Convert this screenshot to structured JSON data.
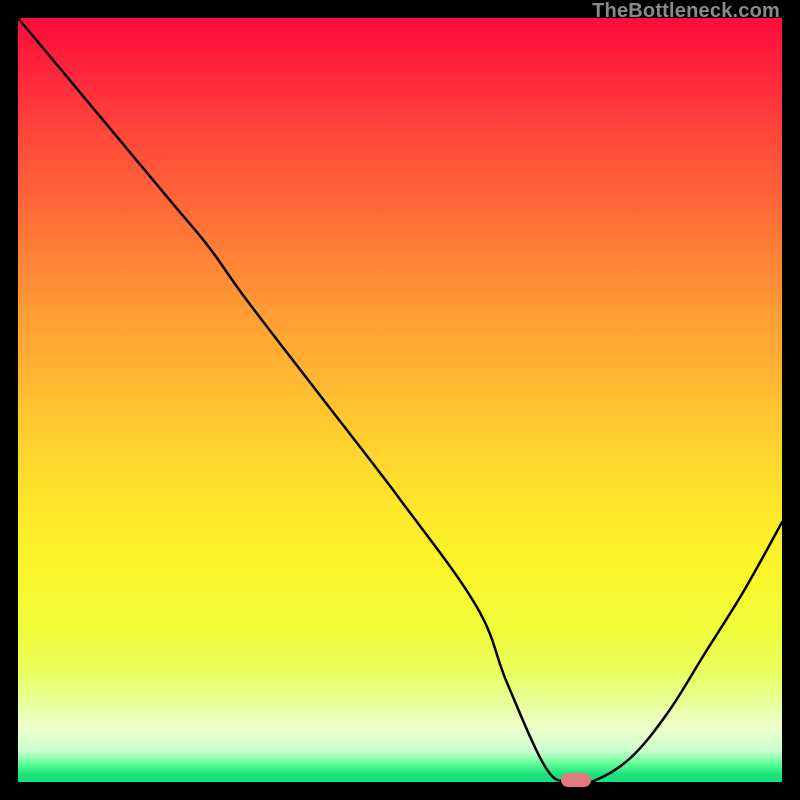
{
  "watermark": "TheBottleneck.com",
  "marker": {
    "color": "#e37b7e"
  },
  "chart_data": {
    "type": "line",
    "title": "",
    "xlabel": "",
    "ylabel": "",
    "xlim": [
      0,
      100
    ],
    "ylim": [
      0,
      100
    ],
    "x": [
      0,
      10,
      20,
      25,
      30,
      40,
      50,
      60,
      64,
      69,
      72,
      75,
      80,
      85,
      90,
      95,
      100
    ],
    "y": [
      100,
      88,
      76,
      70,
      63,
      50,
      37,
      23,
      13,
      2,
      0,
      0,
      3,
      9,
      17,
      25,
      34
    ],
    "marker_point": {
      "x": 73,
      "y": 0
    },
    "background_gradient": {
      "top": "#ff0a3c",
      "mid_upper": "#ff8836",
      "mid": "#ffe92b",
      "mid_lower": "#e9ff63",
      "bottom": "#18e27d"
    }
  }
}
